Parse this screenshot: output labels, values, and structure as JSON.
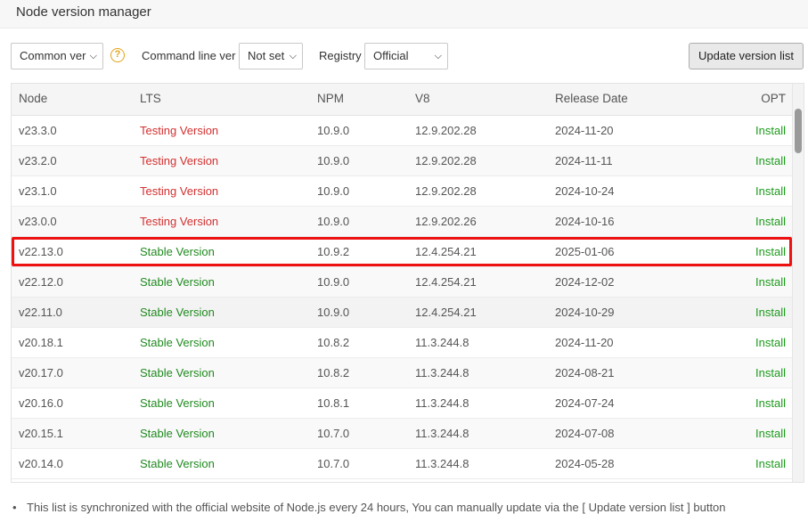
{
  "window": {
    "title": "Node version manager"
  },
  "toolbar": {
    "version_filter": "Common ver",
    "help_icon": "question-circle-icon",
    "command_line_label": "Command line ver",
    "command_line_value": "Not set",
    "registry_label": "Registry",
    "registry_value": "Official",
    "update_button": "Update version list"
  },
  "table": {
    "headers": [
      "Node",
      "LTS",
      "NPM",
      "V8",
      "Release Date",
      "OPT"
    ],
    "rows": [
      {
        "node": "v23.3.0",
        "lts": "Testing Version",
        "npm": "10.9.0",
        "v8": "12.9.202.28",
        "date": "2024-11-20",
        "opt": "Install"
      },
      {
        "node": "v23.2.0",
        "lts": "Testing Version",
        "npm": "10.9.0",
        "v8": "12.9.202.28",
        "date": "2024-11-11",
        "opt": "Install"
      },
      {
        "node": "v23.1.0",
        "lts": "Testing Version",
        "npm": "10.9.0",
        "v8": "12.9.202.28",
        "date": "2024-10-24",
        "opt": "Install"
      },
      {
        "node": "v23.0.0",
        "lts": "Testing Version",
        "npm": "10.9.0",
        "v8": "12.9.202.26",
        "date": "2024-10-16",
        "opt": "Install"
      },
      {
        "node": "v22.13.0",
        "lts": "Stable Version",
        "npm": "10.9.2",
        "v8": "12.4.254.21",
        "date": "2025-01-06",
        "opt": "Install"
      },
      {
        "node": "v22.12.0",
        "lts": "Stable Version",
        "npm": "10.9.0",
        "v8": "12.4.254.21",
        "date": "2024-12-02",
        "opt": "Install"
      },
      {
        "node": "v22.11.0",
        "lts": "Stable Version",
        "npm": "10.9.0",
        "v8": "12.4.254.21",
        "date": "2024-10-29",
        "opt": "Install"
      },
      {
        "node": "v20.18.1",
        "lts": "Stable Version",
        "npm": "10.8.2",
        "v8": "11.3.244.8",
        "date": "2024-11-20",
        "opt": "Install"
      },
      {
        "node": "v20.17.0",
        "lts": "Stable Version",
        "npm": "10.8.2",
        "v8": "11.3.244.8",
        "date": "2024-08-21",
        "opt": "Install"
      },
      {
        "node": "v20.16.0",
        "lts": "Stable Version",
        "npm": "10.8.1",
        "v8": "11.3.244.8",
        "date": "2024-07-24",
        "opt": "Install"
      },
      {
        "node": "v20.15.1",
        "lts": "Stable Version",
        "npm": "10.7.0",
        "v8": "11.3.244.8",
        "date": "2024-07-08",
        "opt": "Install"
      },
      {
        "node": "v20.14.0",
        "lts": "Stable Version",
        "npm": "10.7.0",
        "v8": "11.3.244.8",
        "date": "2024-05-28",
        "opt": "Install"
      }
    ]
  },
  "colors": {
    "testing": "#d32f2f",
    "stable": "#208a20",
    "install": "#1d9b1d",
    "highlight": "#ee1111"
  },
  "note": "This list is synchronized with the official website of Node.js every 24 hours, You can manually update via the [ Update version list ] button"
}
